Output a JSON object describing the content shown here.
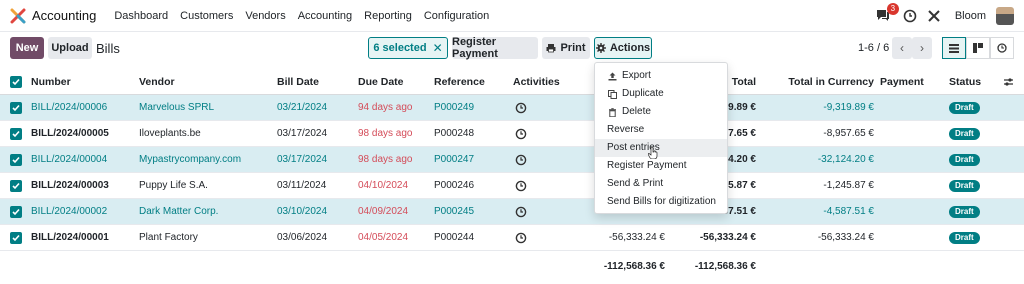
{
  "navbar": {
    "app_name": "Accounting",
    "menu": [
      "Dashboard",
      "Customers",
      "Vendors",
      "Accounting",
      "Reporting",
      "Configuration"
    ],
    "chat_count": "3",
    "company": "Bloom",
    "icons": [
      "chat-icon",
      "clock-icon",
      "tools-icon"
    ]
  },
  "control": {
    "new_label": "New",
    "upload_label": "Upload",
    "title": "Bills",
    "selected_label": "6 selected",
    "register_payment_label": "Register Payment",
    "print_label": "Print",
    "actions_label": "Actions",
    "pager": "1-6 / 6"
  },
  "table": {
    "headers": {
      "number": "Number",
      "vendor": "Vendor",
      "bill_date": "Bill Date",
      "due_date": "Due Date",
      "reference": "Reference",
      "activities": "Activities",
      "total": "Total",
      "total_currency": "Total in Currency",
      "payment": "Payment",
      "status": "Status"
    },
    "rows": [
      {
        "number": "BILL/2024/00006",
        "vendor": "Marvelous SPRL",
        "bill_date": "03/21/2024",
        "due_date": "94 days ago",
        "reference": "P000249",
        "total": "-9,319.89 €",
        "total_currency": "-9,319.89 €",
        "status": "Draft",
        "selected": true
      },
      {
        "number": "BILL/2024/00005",
        "vendor": "Iloveplants.be",
        "bill_date": "03/17/2024",
        "due_date": "98 days ago",
        "reference": "P000248",
        "total": "-8,957.65 €",
        "total_currency": "-8,957.65 €",
        "status": "Draft",
        "selected": false
      },
      {
        "number": "BILL/2024/00004",
        "vendor": "Mypastrycompany.com",
        "bill_date": "03/17/2024",
        "due_date": "98 days ago",
        "reference": "P000247",
        "total": "-32,124.20 €",
        "total_currency": "-32,124.20 €",
        "status": "Draft",
        "selected": true
      },
      {
        "number": "BILL/2024/00003",
        "vendor": "Puppy Life S.A.",
        "bill_date": "03/11/2024",
        "due_date": "04/10/2024",
        "reference": "P000246",
        "total": "-1,245.87 €",
        "total_currency": "-1,245.87 €",
        "status": "Draft",
        "selected": false
      },
      {
        "number": "BILL/2024/00002",
        "vendor": "Dark Matter Corp.",
        "bill_date": "03/10/2024",
        "due_date": "04/09/2024",
        "reference": "P000245",
        "total": "-4,587.51 €",
        "total_currency": "-4,587.51 €",
        "status": "Draft",
        "selected": true
      },
      {
        "number": "BILL/2024/00001",
        "vendor": "Plant Factory",
        "bill_date": "03/06/2024",
        "due_date": "04/05/2024",
        "reference": "P000244",
        "untaxed": "-56,333.24 €",
        "total": "-56,333.24 €",
        "total_currency": "-56,333.24 €",
        "status": "Draft",
        "selected": false
      }
    ],
    "visible_totals": [
      "319.89 €",
      "957.65 €",
      "24.20 €",
      "45.87 €",
      "587.51 €",
      "-56,333.24 €"
    ],
    "footer": {
      "untaxed_total": "-112,568.36 €",
      "total": "-112,568.36 €"
    }
  },
  "actions_menu": [
    {
      "label": "Export",
      "icon": "upload-icon"
    },
    {
      "label": "Duplicate",
      "icon": "copy-icon"
    },
    {
      "label": "Delete",
      "icon": "trash-icon"
    },
    {
      "label": "Reverse",
      "icon": ""
    },
    {
      "label": "Post entries",
      "icon": ""
    },
    {
      "label": "Register Payment",
      "icon": ""
    },
    {
      "label": "Send & Print",
      "icon": ""
    },
    {
      "label": "Send Bills for digitization",
      "icon": ""
    }
  ],
  "colors": {
    "brand": "#714b67",
    "accent": "#017e84",
    "danger": "#d44c59",
    "selected_row": "#d9edf2"
  }
}
